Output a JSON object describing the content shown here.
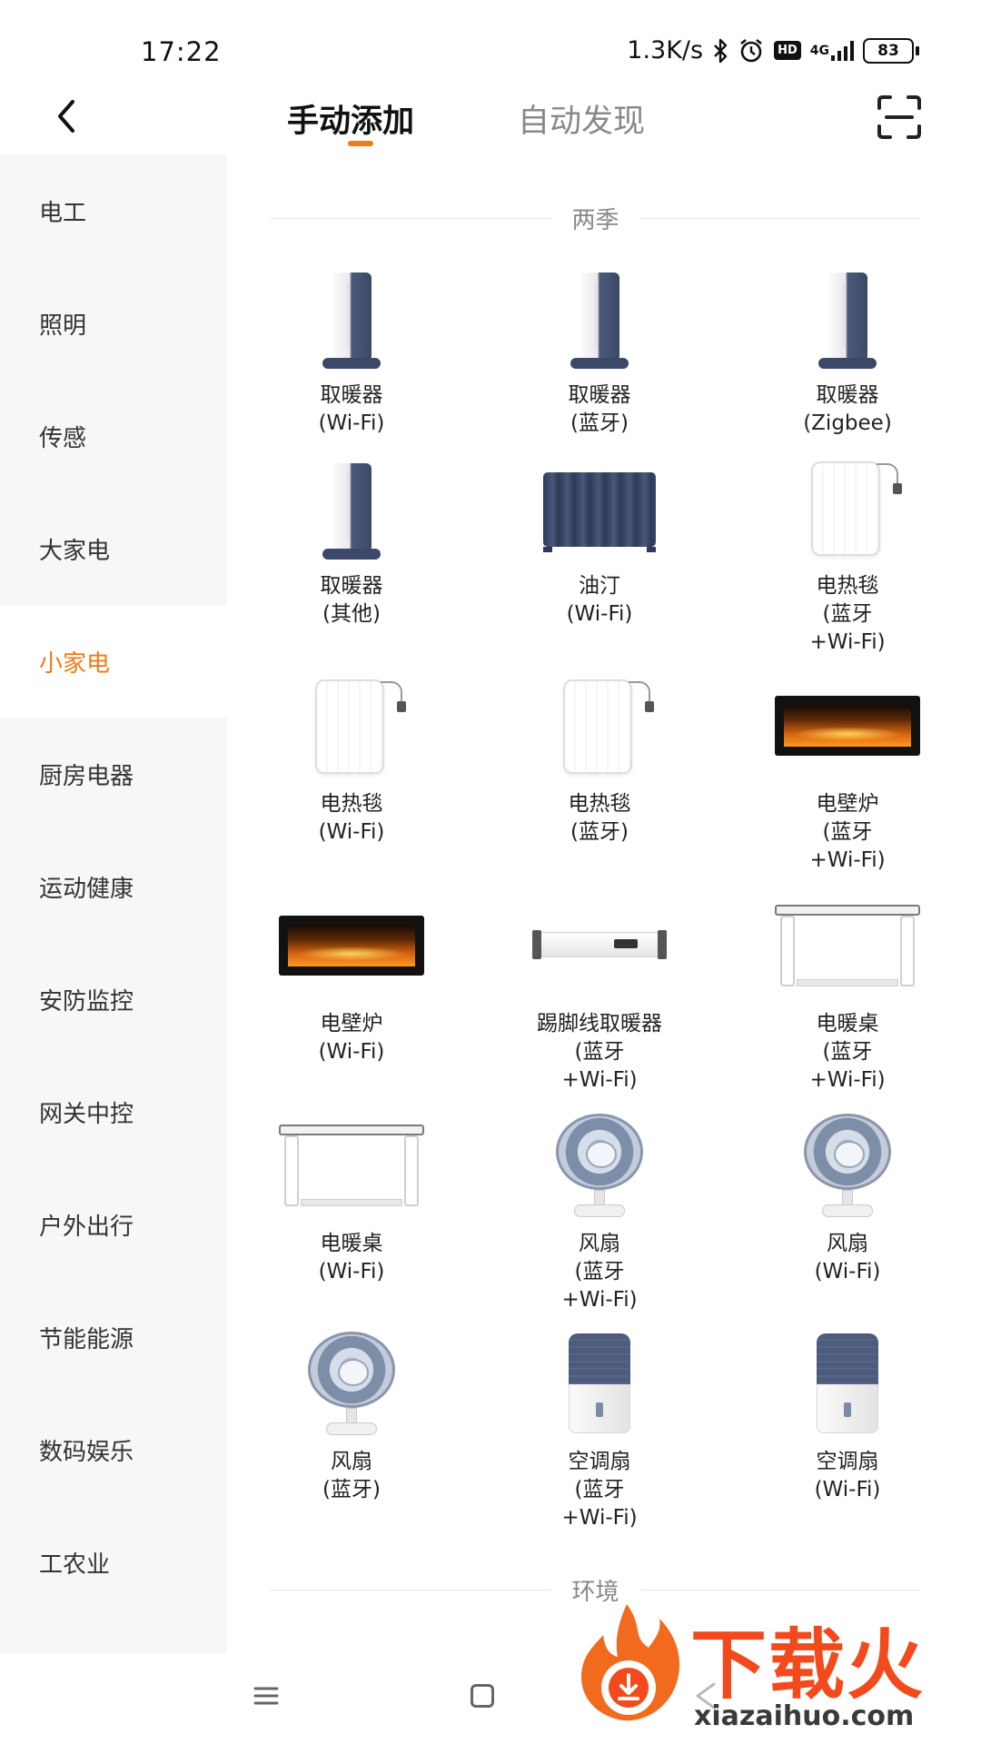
{
  "status_bar": {
    "time": "17:22",
    "net_speed": "1.3K/s",
    "hd_badge": "HD",
    "signal_type": "4G",
    "battery": "83"
  },
  "header": {
    "tabs": [
      {
        "label": "手动添加",
        "active": true
      },
      {
        "label": "自动发现",
        "active": false
      }
    ],
    "accent_color": "#f07b16"
  },
  "sidebar": {
    "items": [
      {
        "label": "电工"
      },
      {
        "label": "照明"
      },
      {
        "label": "传感"
      },
      {
        "label": "大家电"
      },
      {
        "label": "小家电",
        "active": true
      },
      {
        "label": "厨房电器"
      },
      {
        "label": "运动健康"
      },
      {
        "label": "安防监控"
      },
      {
        "label": "网关中控"
      },
      {
        "label": "户外出行"
      },
      {
        "label": "节能能源"
      },
      {
        "label": "数码娱乐"
      },
      {
        "label": "工农业"
      }
    ]
  },
  "sections": [
    {
      "title": "两季",
      "devices": [
        {
          "name": "取暖器\n(Wi-Fi)",
          "icon": "tower-heater"
        },
        {
          "name": "取暖器\n(蓝牙)",
          "icon": "tower-heater"
        },
        {
          "name": "取暖器\n(Zigbee)",
          "icon": "tower-heater"
        },
        {
          "name": "取暖器\n(其他)",
          "icon": "tower-heater"
        },
        {
          "name": "油汀\n(Wi-Fi)",
          "icon": "oil-heater"
        },
        {
          "name": "电热毯\n(蓝牙\n+Wi-Fi)",
          "icon": "electric-blanket"
        },
        {
          "name": "电热毯\n(Wi-Fi)",
          "icon": "electric-blanket"
        },
        {
          "name": "电热毯\n(蓝牙)",
          "icon": "electric-blanket"
        },
        {
          "name": "电壁炉\n(蓝牙\n+Wi-Fi)",
          "icon": "electric-fireplace"
        },
        {
          "name": "电壁炉\n(Wi-Fi)",
          "icon": "electric-fireplace"
        },
        {
          "name": "踢脚线取暖器\n(蓝牙\n+Wi-Fi)",
          "icon": "baseboard-heater"
        },
        {
          "name": "电暖桌\n(蓝牙\n+Wi-Fi)",
          "icon": "heating-desk"
        },
        {
          "name": "电暖桌\n(Wi-Fi)",
          "icon": "heating-desk"
        },
        {
          "name": "风扇\n(蓝牙\n+Wi-Fi)",
          "icon": "fan"
        },
        {
          "name": "风扇\n(Wi-Fi)",
          "icon": "fan"
        },
        {
          "name": "风扇\n(蓝牙)",
          "icon": "fan"
        },
        {
          "name": "空调扇\n(蓝牙\n+Wi-Fi)",
          "icon": "air-cooler"
        },
        {
          "name": "空调扇\n(Wi-Fi)",
          "icon": "air-cooler"
        }
      ]
    },
    {
      "title": "环境",
      "devices": []
    }
  ],
  "watermark": {
    "title": "下载火",
    "url": "xiazaihuo.com"
  }
}
